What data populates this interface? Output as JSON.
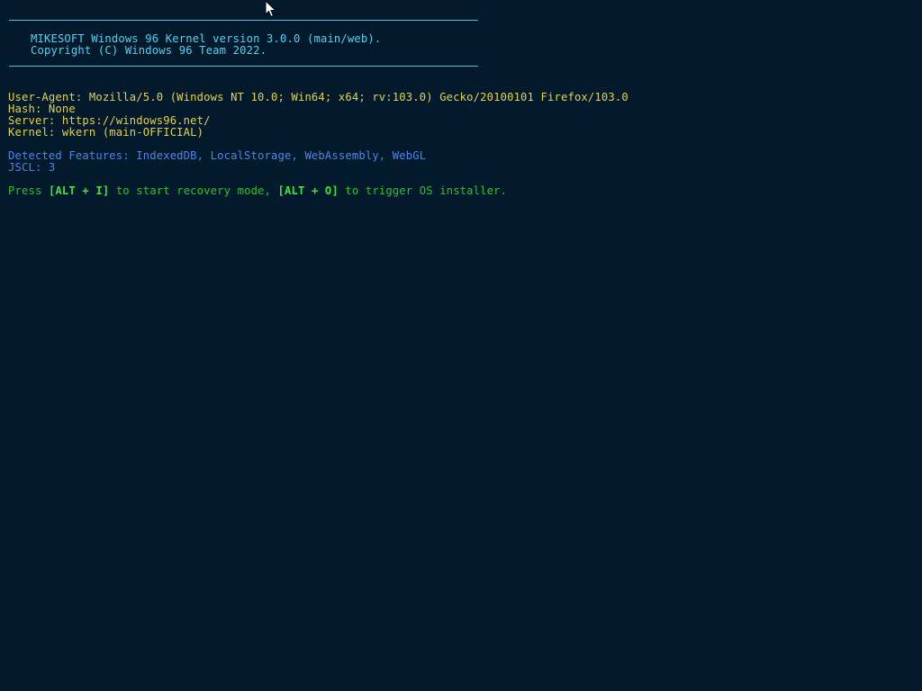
{
  "banner": {
    "line1": "MIKESOFT Windows 96 Kernel version 3.0.0 (main/web).",
    "line2": "Copyright (C) Windows 96 Team 2022."
  },
  "info": {
    "user_agent": "User-Agent: Mozilla/5.0 (Windows NT 10.0; Win64; x64; rv:103.0) Gecko/20100101 Firefox/103.0",
    "hash": "Hash: None",
    "server": "Server: https://windows96.net/",
    "kernel": "Kernel: wkern (main-OFFICIAL)"
  },
  "features": {
    "detected": "Detected Features: IndexedDB, LocalStorage, WebAssembly, WebGL",
    "jscl": "JSCL: 3"
  },
  "prompt": {
    "press": "Press ",
    "key_recovery": "[ALT + I]",
    "mid": " to start recovery mode, ",
    "key_installer": "[ALT + O]",
    "end": " to trigger OS installer."
  },
  "colors": {
    "background": "#021a2b",
    "banner": "#4fd3f3",
    "info": "#e3d34b",
    "features": "#4a86e8",
    "prompt": "#29c52a"
  },
  "icons": {
    "cursor": "mouse-pointer-icon"
  }
}
